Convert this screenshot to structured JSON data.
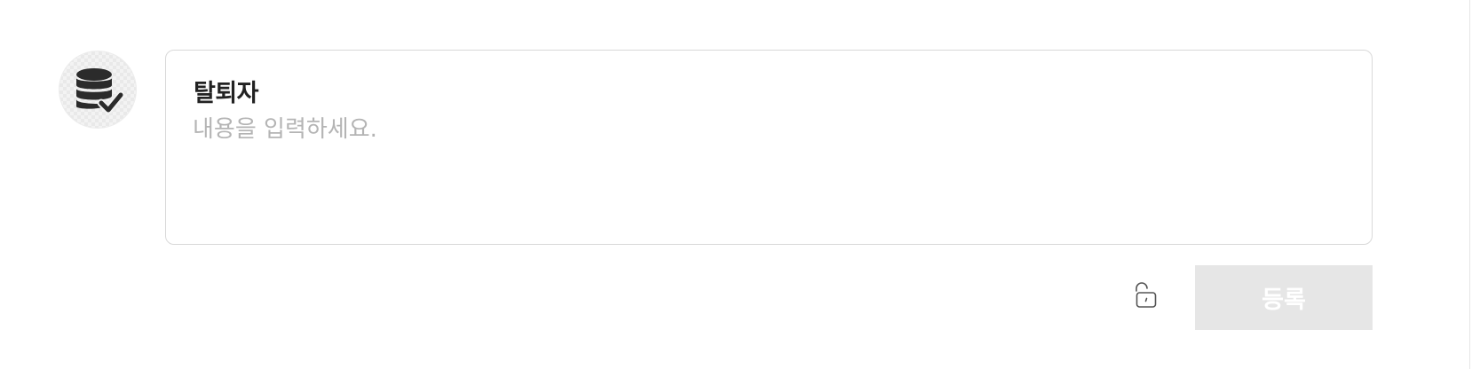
{
  "comment_form": {
    "author": "탈퇴자",
    "avatar_icon": "database-check-icon",
    "input": {
      "value": "",
      "placeholder": "내용을 입력하세요."
    },
    "lock_icon": "unlock-icon",
    "submit_label": "등록"
  },
  "colors": {
    "border": "#d9d9d9",
    "placeholder": "#b4b4b4",
    "button_bg": "#e6e6e6",
    "icon": "#2b2b2b"
  }
}
